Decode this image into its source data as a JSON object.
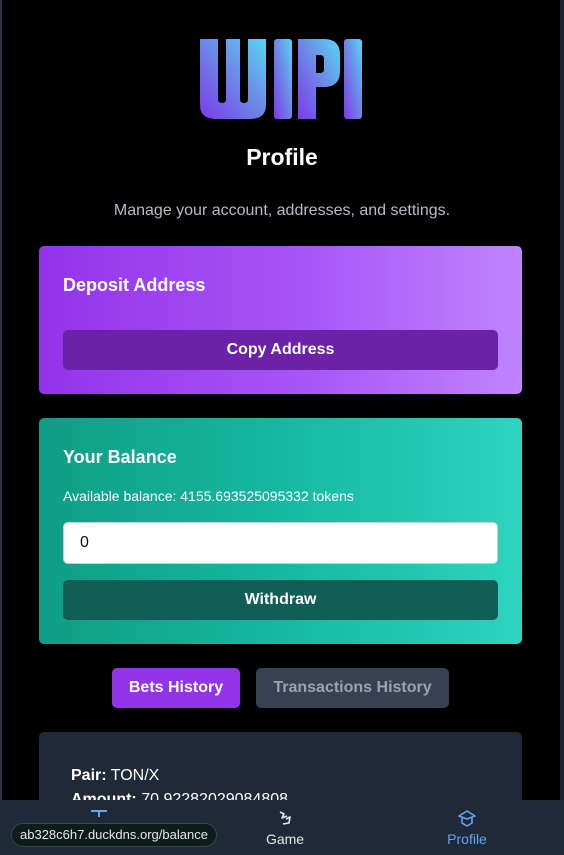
{
  "header": {
    "logo_text": "WIPI",
    "title": "Profile",
    "subtitle": "Manage your account, addresses, and settings."
  },
  "deposit": {
    "title": "Deposit Address",
    "copy_label": "Copy Address"
  },
  "balance": {
    "title": "Your Balance",
    "available_text": "Available balance: 4155.693525095332 tokens",
    "input_value": "0",
    "withdraw_label": "Withdraw"
  },
  "history_tabs": [
    {
      "label": "Bets History",
      "active": true
    },
    {
      "label": "Transactions History",
      "active": false
    }
  ],
  "history": {
    "entries": [
      {
        "pair_label": "Pair:",
        "pair_value": "TON/X",
        "amount_label": "Amount:",
        "amount_value": "70.92282029084808"
      }
    ]
  },
  "bottom_nav": {
    "items": [
      {
        "label": "Game",
        "icon": "game-icon",
        "active": false
      },
      {
        "label": "Profile",
        "icon": "profile-icon",
        "active": true
      }
    ]
  },
  "status_url": "ab328c6h7.duckdns.org/balance",
  "colors": {
    "deposit_card": "#a855f7",
    "copy_button": "#6b21a8",
    "balance_card": "#14b8a6",
    "withdraw_button": "#115e56",
    "active_tab": "#9333ea",
    "inactive_tab": "#374151",
    "nav_active": "#60a5fa"
  }
}
